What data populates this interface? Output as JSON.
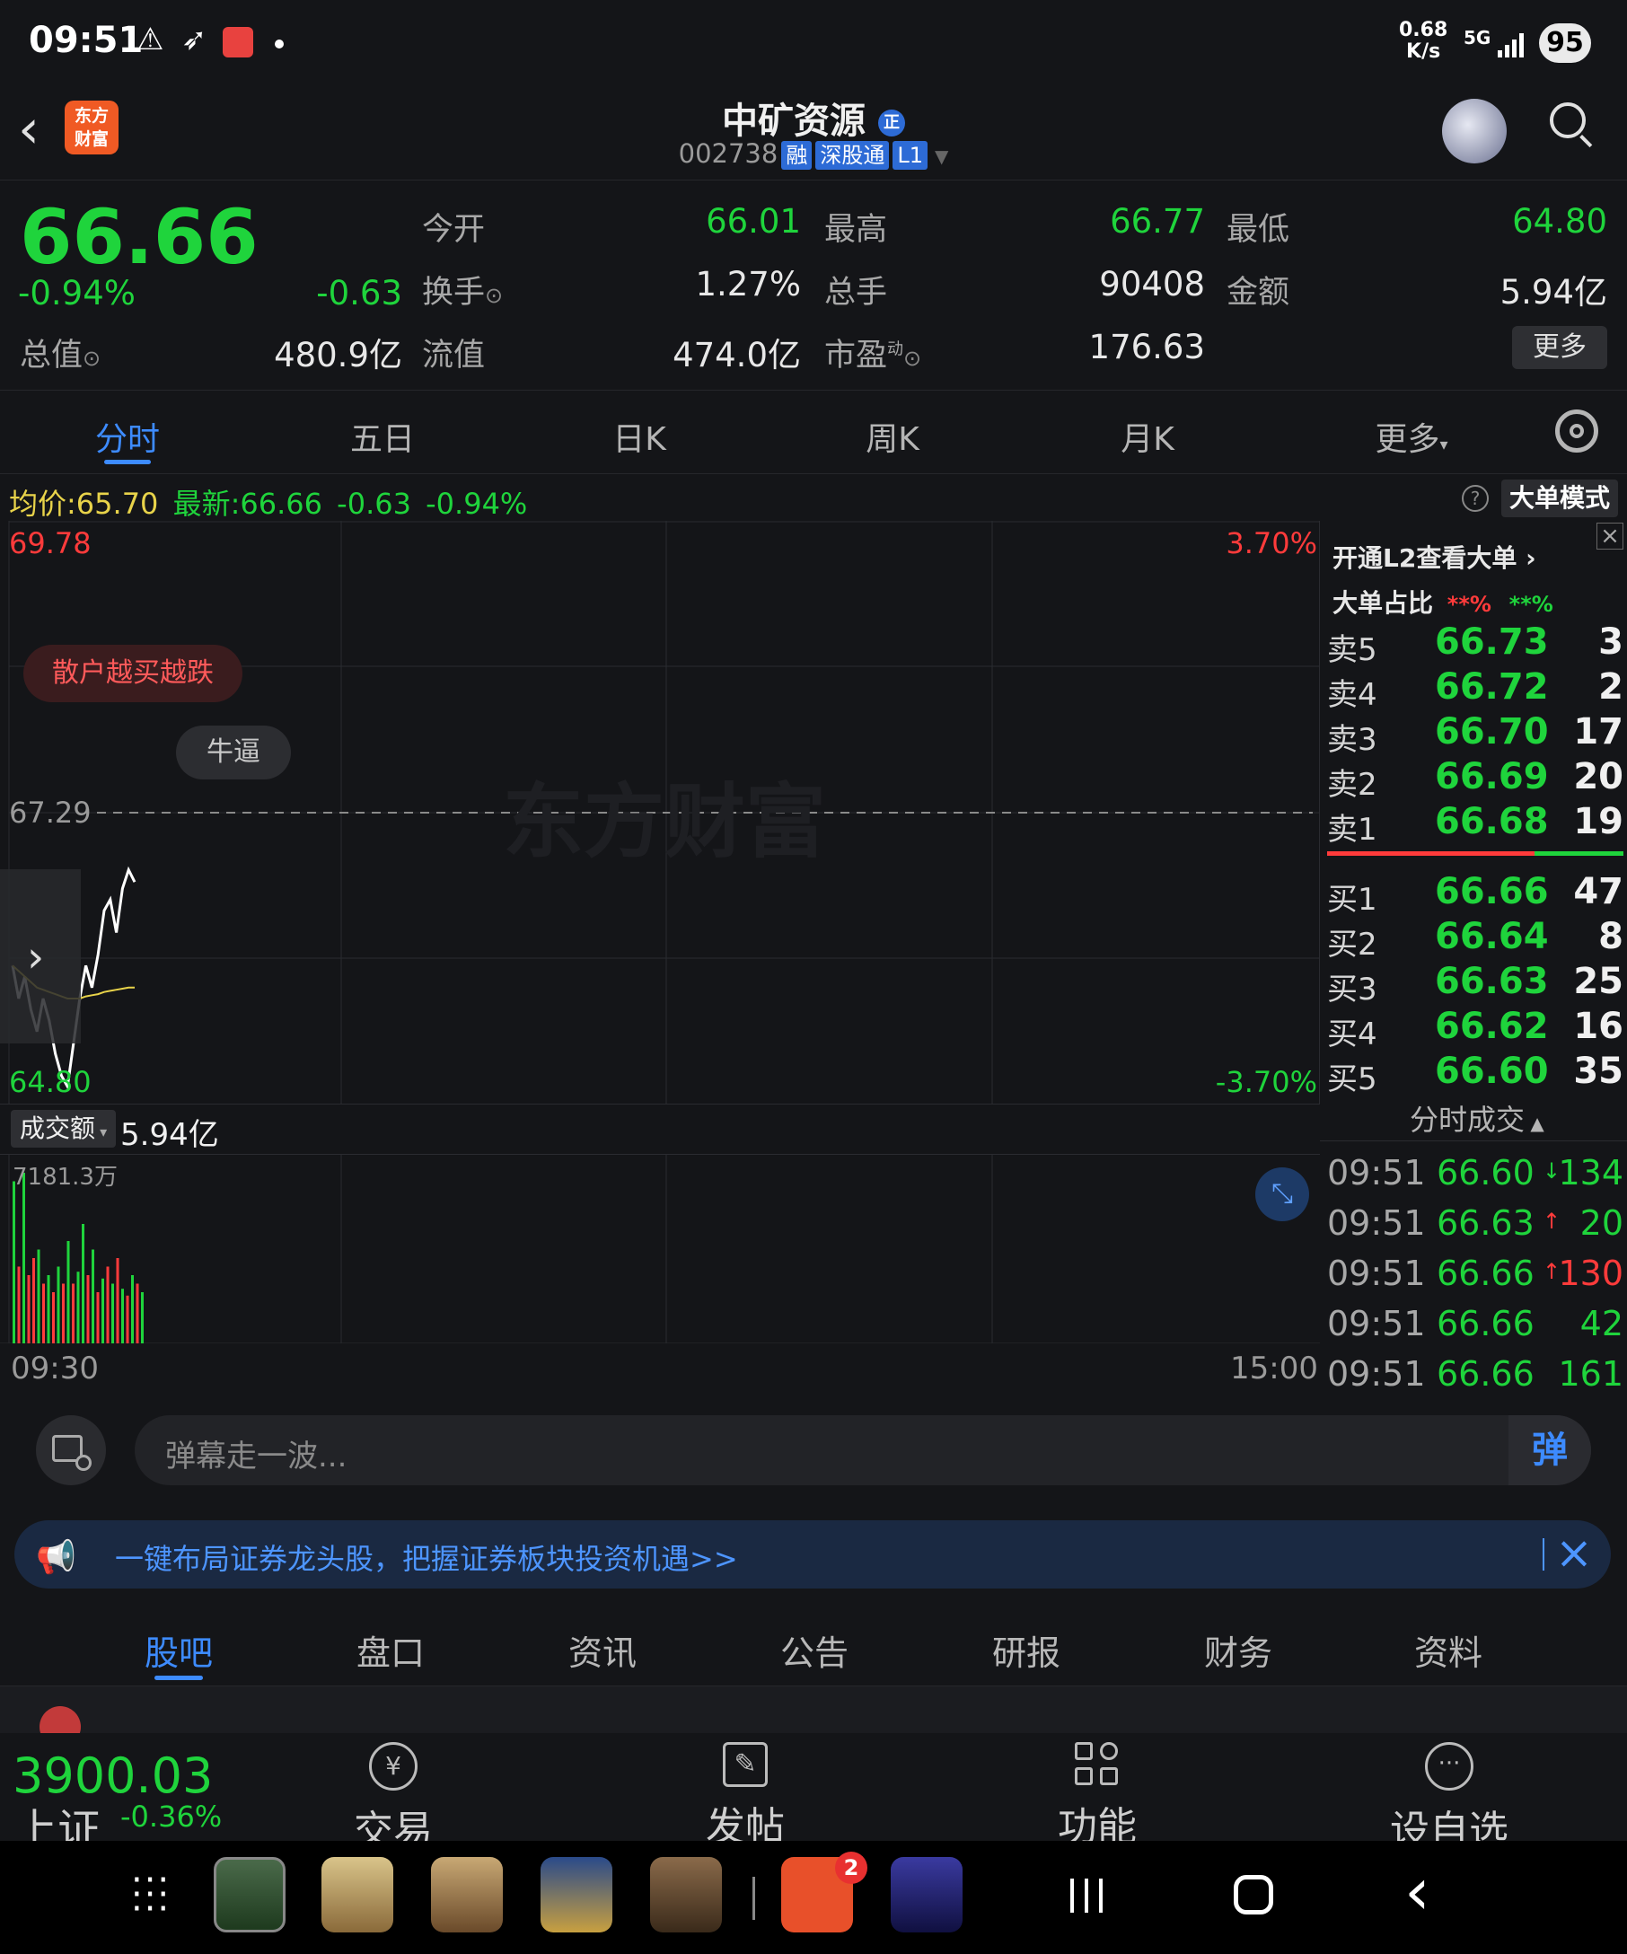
{
  "status": {
    "time": "09:51",
    "net_speed_top": "0.68",
    "net_speed_unit": "K/s",
    "network": "5G",
    "battery": "95"
  },
  "header": {
    "title": "中矿资源",
    "title_badge": "正",
    "code": "002738",
    "tags": [
      "融",
      "深股通",
      "L1"
    ]
  },
  "quote": {
    "price": "66.66",
    "pct": "-0.94%",
    "change": "-0.63",
    "total_value_label": "总值",
    "total_value": "480.9亿",
    "float_value_label": "流值",
    "float_value": "474.0亿",
    "open_label": "今开",
    "open": "66.01",
    "high_label": "最高",
    "high": "66.77",
    "low_label": "最低",
    "low": "64.80",
    "turnover_label": "换手",
    "turnover": "1.27%",
    "volume_label": "总手",
    "volume": "90408",
    "amount_label": "金额",
    "amount": "5.94亿",
    "pe_label": "市盈",
    "pe_sup": "动",
    "pe": "176.63",
    "more_button": "更多"
  },
  "period_tabs": [
    "分时",
    "五日",
    "日K",
    "周K",
    "月K",
    "更多"
  ],
  "chart_info": {
    "avg_label": "均价:",
    "avg": "65.70",
    "latest_label": "最新:",
    "latest": "66.66",
    "change": "-0.63",
    "pct": "-0.94%",
    "mode_button": "大单模式"
  },
  "chart": {
    "y_max": "69.78",
    "y_mid": "67.29",
    "y_min": "64.80",
    "pct_max": "3.70%",
    "pct_min": "-3.70%",
    "watermark": "东方财富",
    "danmaku_1": "散户越买越跌",
    "danmaku_2": "牛逼",
    "x_start": "09:30",
    "x_end": "15:00",
    "vol_selector": "成交额",
    "vol_total": "5.94亿",
    "vol_max": "7181.3万",
    "colors": {
      "price": "#ffffff",
      "avg": "#e8d34a",
      "up": "#ff3b3b",
      "down": "#1fd43c"
    }
  },
  "chart_data": {
    "type": "line",
    "title": "",
    "ylim": [
      64.8,
      69.78
    ],
    "series": [
      {
        "values": [
          65.9,
          65.6,
          65.8,
          65.5,
          65.3,
          65.6,
          65.4,
          65.1,
          64.9,
          64.8,
          65.2,
          65.6,
          65.9,
          65.7,
          66.0,
          66.4,
          66.5,
          66.2,
          66.6,
          66.77,
          66.66
        ]
      },
      {
        "values": [
          65.9,
          65.85,
          65.8,
          65.75,
          65.7,
          65.68,
          65.66,
          65.64,
          65.62,
          65.6,
          65.6,
          65.6,
          65.62,
          65.63,
          65.64,
          65.66,
          65.67,
          65.68,
          65.69,
          65.7,
          65.7
        ]
      }
    ],
    "volume": [
      0.95,
      0.45,
      1.0,
      0.4,
      0.5,
      0.55,
      0.35,
      0.4,
      0.3,
      0.45,
      0.35,
      0.6,
      0.35,
      0.42,
      0.7,
      0.4,
      0.55,
      0.3,
      0.38,
      0.45,
      0.35,
      0.5,
      0.32,
      0.28,
      0.4,
      0.35,
      0.3
    ],
    "volume_up": [
      false,
      true,
      false,
      true,
      true,
      false,
      true,
      false,
      true,
      false,
      true,
      false,
      true,
      false,
      false,
      true,
      false,
      true,
      false,
      true,
      false,
      true,
      false,
      true,
      false,
      true,
      false
    ]
  },
  "orderbook": {
    "l2_prompt": "开通L2查看大单",
    "big_ratio_label": "大单占比",
    "big_ratio_up": "**%",
    "big_ratio_down": "**%",
    "asks": [
      {
        "name": "卖5",
        "price": "66.73",
        "vol": "3"
      },
      {
        "name": "卖4",
        "price": "66.72",
        "vol": "2"
      },
      {
        "name": "卖3",
        "price": "66.70",
        "vol": "17"
      },
      {
        "name": "卖2",
        "price": "66.69",
        "vol": "20"
      },
      {
        "name": "卖1",
        "price": "66.68",
        "vol": "19"
      }
    ],
    "bids": [
      {
        "name": "买1",
        "price": "66.66",
        "vol": "47"
      },
      {
        "name": "买2",
        "price": "66.64",
        "vol": "8"
      },
      {
        "name": "买3",
        "price": "66.63",
        "vol": "25"
      },
      {
        "name": "买4",
        "price": "66.62",
        "vol": "16"
      },
      {
        "name": "买5",
        "price": "66.60",
        "vol": "35"
      }
    ],
    "trades_title": "分时成交",
    "trades": [
      {
        "time": "09:51",
        "price": "66.60",
        "arrow": "↓",
        "vol": "134",
        "color": "#1fd43c"
      },
      {
        "time": "09:51",
        "price": "66.63",
        "arrow": "↑",
        "vol": "20",
        "color": "#1fd43c"
      },
      {
        "time": "09:51",
        "price": "66.66",
        "arrow": "↑",
        "vol": "130",
        "color": "#ff3b3b"
      },
      {
        "time": "09:51",
        "price": "66.66",
        "arrow": "",
        "vol": "42",
        "color": "#1fd43c"
      },
      {
        "time": "09:51",
        "price": "66.66",
        "arrow": "",
        "vol": "161",
        "color": "#1fd43c"
      }
    ]
  },
  "danmaku": {
    "placeholder": "弹幕走一波...",
    "send_button": "弹"
  },
  "promo": {
    "text": "一键布局证券龙头股，把握证券板块投资机遇>>"
  },
  "bottom_tabs": [
    "股吧",
    "盘口",
    "资讯",
    "公告",
    "研报",
    "财务",
    "资料"
  ],
  "bottom_bar": {
    "index_value": "3900.03",
    "index_name": "上证",
    "index_pct": "-0.36%",
    "items": [
      {
        "icon": "yen-circle-icon",
        "label": "交易"
      },
      {
        "icon": "edit-icon",
        "label": "发帖"
      },
      {
        "icon": "grid-icon",
        "label": "功能"
      },
      {
        "icon": "more-circle-icon",
        "label": "设自选"
      }
    ]
  },
  "navbar": {
    "badge": "2"
  }
}
